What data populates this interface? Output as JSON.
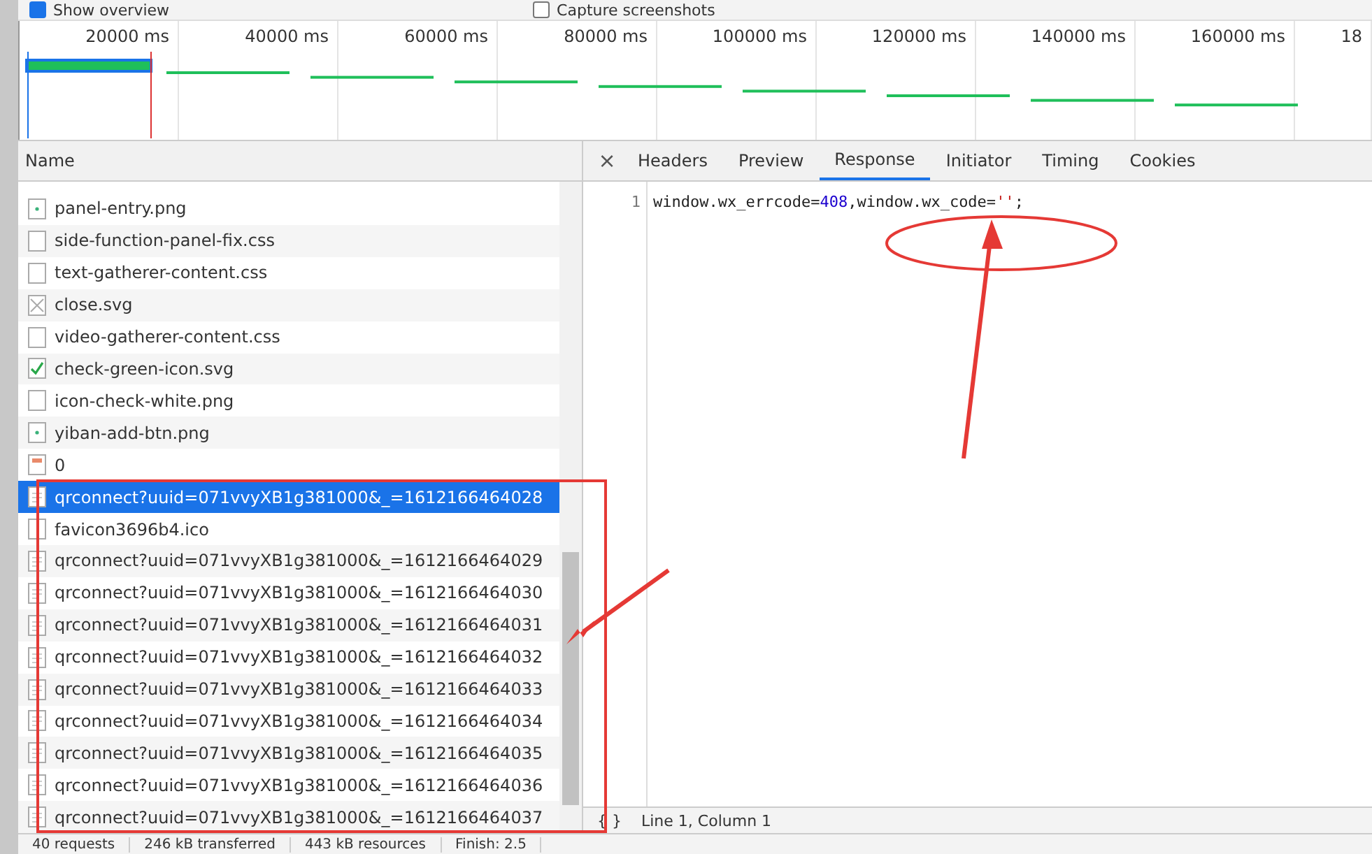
{
  "toolbar": {
    "options": [
      {
        "label": "Show overview",
        "checked": true
      },
      {
        "label": "Capture screenshots",
        "checked": false
      }
    ]
  },
  "overview": {
    "ticks": [
      "20000 ms",
      "40000 ms",
      "60000 ms",
      "80000 ms",
      "100000 ms",
      "120000 ms",
      "140000 ms",
      "160000 ms",
      "18"
    ]
  },
  "requests": {
    "column": "Name",
    "rows": [
      {
        "name": "panel-entry.png",
        "kind": "image",
        "selected": false
      },
      {
        "name": "side-function-panel-fix.css",
        "kind": "document",
        "selected": false
      },
      {
        "name": "text-gatherer-content.css",
        "kind": "document",
        "selected": false
      },
      {
        "name": "close.svg",
        "kind": "cross",
        "selected": false
      },
      {
        "name": "video-gatherer-content.css",
        "kind": "document",
        "selected": false
      },
      {
        "name": "check-green-icon.svg",
        "kind": "check",
        "selected": false
      },
      {
        "name": "icon-check-white.png",
        "kind": "document",
        "selected": false
      },
      {
        "name": "yiban-add-btn.png",
        "kind": "image",
        "selected": false
      },
      {
        "name": "0",
        "kind": "error",
        "selected": false
      },
      {
        "name": "qrconnect?uuid=071vvyXB1g381000&_=1612166464028",
        "kind": "script",
        "selected": true
      },
      {
        "name": "favicon3696b4.ico",
        "kind": "document",
        "selected": false
      },
      {
        "name": "qrconnect?uuid=071vvyXB1g381000&_=1612166464029",
        "kind": "script",
        "selected": false
      },
      {
        "name": "qrconnect?uuid=071vvyXB1g381000&_=1612166464030",
        "kind": "script",
        "selected": false
      },
      {
        "name": "qrconnect?uuid=071vvyXB1g381000&_=1612166464031",
        "kind": "script",
        "selected": false
      },
      {
        "name": "qrconnect?uuid=071vvyXB1g381000&_=1612166464032",
        "kind": "script",
        "selected": false
      },
      {
        "name": "qrconnect?uuid=071vvyXB1g381000&_=1612166464033",
        "kind": "script",
        "selected": false
      },
      {
        "name": "qrconnect?uuid=071vvyXB1g381000&_=1612166464034",
        "kind": "script",
        "selected": false
      },
      {
        "name": "qrconnect?uuid=071vvyXB1g381000&_=1612166464035",
        "kind": "script",
        "selected": false
      },
      {
        "name": "qrconnect?uuid=071vvyXB1g381000&_=1612166464036",
        "kind": "script",
        "selected": false
      },
      {
        "name": "qrconnect?uuid=071vvyXB1g381000&_=1612166464037",
        "kind": "script",
        "selected": false
      }
    ]
  },
  "detail": {
    "close": "×",
    "tabs": [
      {
        "label": "Headers",
        "selected": false
      },
      {
        "label": "Preview",
        "selected": false
      },
      {
        "label": "Response",
        "selected": true
      },
      {
        "label": "Initiator",
        "selected": false
      },
      {
        "label": "Timing",
        "selected": false
      },
      {
        "label": "Cookies",
        "selected": false
      }
    ],
    "lines": [
      {
        "number": "1",
        "tokens": [
          {
            "text": "window.wx_errcode=",
            "kind": "plain"
          },
          {
            "text": "408",
            "kind": "number"
          },
          {
            "text": ",window.wx_code=",
            "kind": "plain"
          },
          {
            "text": "''",
            "kind": "string"
          },
          {
            "text": ";",
            "kind": "plain"
          }
        ]
      }
    ],
    "footer": {
      "format": "{ }",
      "position": "Line 1, Column 1"
    }
  },
  "status_bar": [
    "40 requests",
    "246 kB transferred",
    "443 kB resources",
    "Finish: 2.5"
  ]
}
